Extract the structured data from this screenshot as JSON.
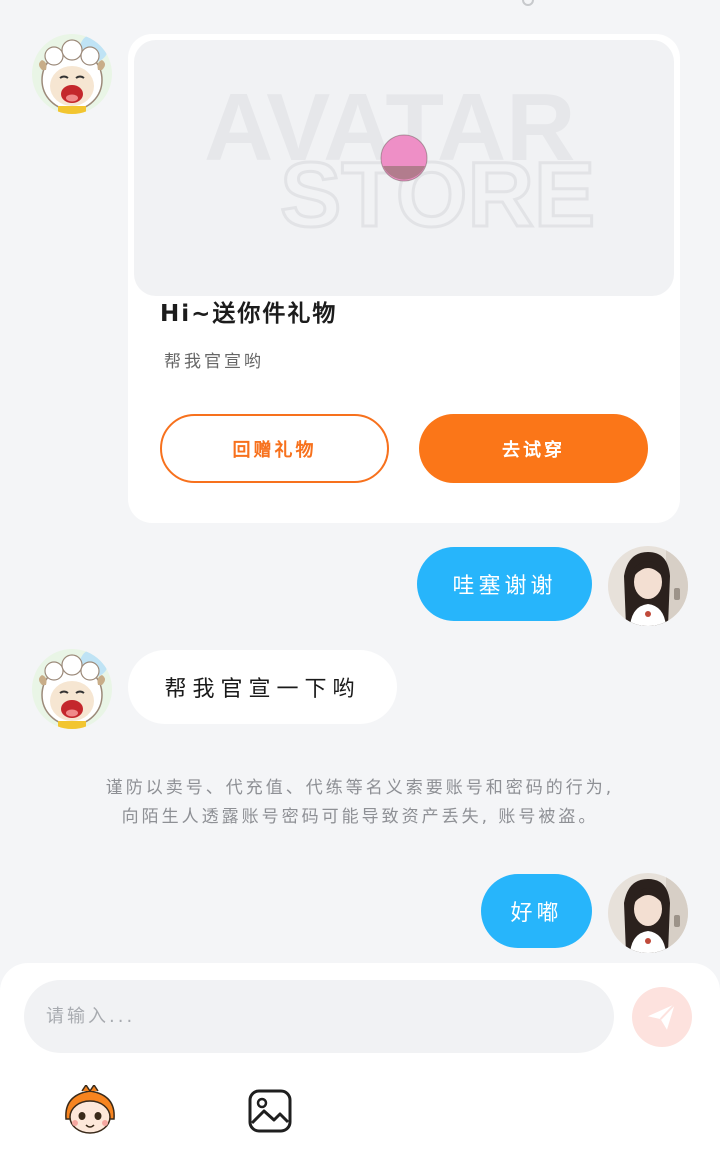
{
  "gift_card": {
    "image_text_line1": "AVATAR",
    "image_text_line2": "STORE",
    "title": "Hi~送你件礼物",
    "subtitle": "帮我官宣哟",
    "return_gift_label": "回赠礼物",
    "try_on_label": "去试穿"
  },
  "messages": [
    {
      "side": "right",
      "text": "哇塞谢谢"
    },
    {
      "side": "left",
      "text": "帮我官宣一下哟"
    },
    {
      "side": "right",
      "text": "好嘟"
    }
  ],
  "notice": {
    "line1": "谨防以卖号、代充值、代练等名义索要账号和密码的行为,",
    "line2": "向陌生人透露账号密码可能导致资产丢失, 账号被盗。"
  },
  "input": {
    "placeholder": "请输入..."
  },
  "colors": {
    "accent_orange": "#fb7618",
    "bubble_blue": "#27b5fb",
    "send_disabled": "#fde2de"
  },
  "icons": {
    "send": "paper-plane-icon",
    "avatar_tool": "character-face-icon",
    "image_tool": "image-icon"
  }
}
